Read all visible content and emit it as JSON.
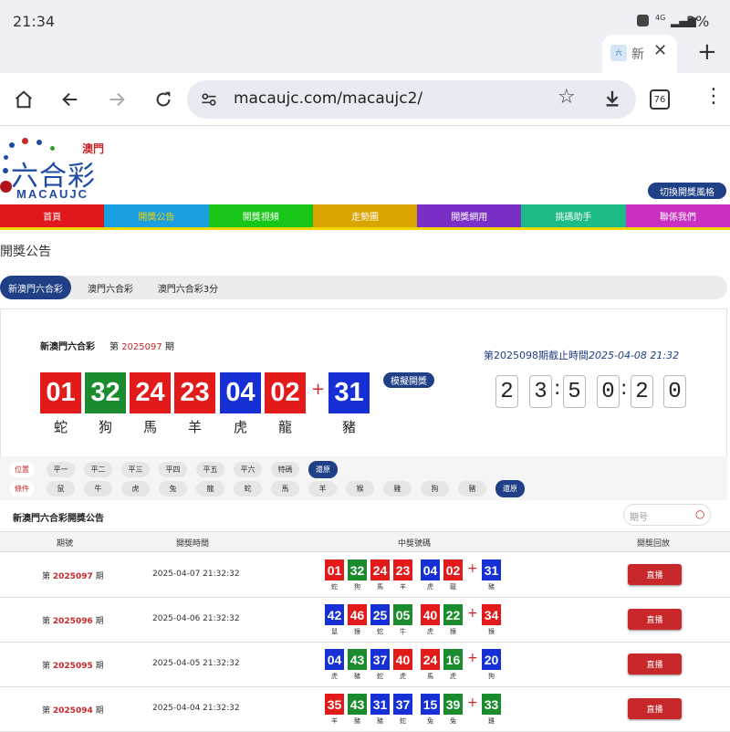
{
  "status_bar": {
    "time": "21:34",
    "signal": "4G",
    "battery": "3%"
  },
  "browser": {
    "tab_title": "新",
    "url": "macaujc.com/macaujc2/",
    "tab_count": "76"
  },
  "logo": {
    "city": "澳門",
    "title": "六合彩",
    "brand": "MACAUJC"
  },
  "switch_style_label": "切換開獎風格",
  "nav": [
    {
      "label": "首頁",
      "color": "#e0171d"
    },
    {
      "label": "開獎公告",
      "color": "#1a9fe0",
      "active_text_color": "#f2d600"
    },
    {
      "label": "開獎視頻",
      "color": "#17c617"
    },
    {
      "label": "走勢圖",
      "color": "#d9a300"
    },
    {
      "label": "開獎網用",
      "color": "#7a2fc7"
    },
    {
      "label": "挑碼助手",
      "color": "#1dbb86"
    },
    {
      "label": "聯係我們",
      "color": "#c930c2"
    }
  ],
  "page_heading": "開獎公告",
  "lottery_tabs": [
    "新澳門六合彩",
    "澳門六合彩",
    "澳門六合彩3分"
  ],
  "current_draw": {
    "name": "新澳門六合彩",
    "period_prefix": "第",
    "period": "2025097",
    "period_suffix": "期",
    "simulate_label": "模擬開獎",
    "plus": "+",
    "balls": [
      {
        "num": "01",
        "zodiac": "蛇",
        "color": "red"
      },
      {
        "num": "32",
        "zodiac": "狗",
        "color": "green"
      },
      {
        "num": "24",
        "zodiac": "馬",
        "color": "red"
      },
      {
        "num": "23",
        "zodiac": "羊",
        "color": "red"
      },
      {
        "num": "04",
        "zodiac": "虎",
        "color": "blue"
      },
      {
        "num": "02",
        "zodiac": "龍",
        "color": "red"
      }
    ],
    "special": {
      "num": "31",
      "zodiac": "豬",
      "color": "blue"
    }
  },
  "next_draw": {
    "label": "第2025098期截止時間",
    "datetime": "2025-04-08 21:32",
    "countdown_digits": [
      "2",
      "3",
      "5",
      "0",
      "2",
      "0"
    ]
  },
  "filters": {
    "position_label": "位置",
    "positions": [
      "平一",
      "平二",
      "平三",
      "平四",
      "平五",
      "平六",
      "特碼"
    ],
    "restore_label": "還原",
    "condition_label": "條件",
    "conditions": [
      "鼠",
      "牛",
      "虎",
      "兔",
      "龍",
      "蛇",
      "馬",
      "羊",
      "猴",
      "雞",
      "狗",
      "豬"
    ]
  },
  "history": {
    "title": "新澳門六合彩開獎公告",
    "search_placeholder": "期号",
    "columns": [
      "期號",
      "開獎時間",
      "中獎號碼",
      "開獎回放"
    ],
    "replay_label": "直播",
    "rows": [
      {
        "period": "2025097",
        "time": "2025-04-07 21:32:32",
        "balls": [
          [
            "01",
            "蛇",
            "red"
          ],
          [
            "32",
            "狗",
            "green"
          ],
          [
            "24",
            "馬",
            "red"
          ],
          [
            "23",
            "羊",
            "red"
          ],
          [
            "04",
            "虎",
            "blue"
          ],
          [
            "02",
            "龍",
            "red"
          ]
        ],
        "special": [
          "31",
          "豬",
          "blue"
        ]
      },
      {
        "period": "2025096",
        "time": "2025-04-06 21:32:32",
        "balls": [
          [
            "42",
            "鼠",
            "blue"
          ],
          [
            "46",
            "猴",
            "red"
          ],
          [
            "25",
            "蛇",
            "blue"
          ],
          [
            "05",
            "牛",
            "green"
          ],
          [
            "40",
            "虎",
            "red"
          ],
          [
            "22",
            "猴",
            "green"
          ]
        ],
        "special": [
          "34",
          "猴",
          "red"
        ]
      },
      {
        "period": "2025095",
        "time": "2025-04-05 21:32:32",
        "balls": [
          [
            "04",
            "虎",
            "blue"
          ],
          [
            "43",
            "豬",
            "green"
          ],
          [
            "37",
            "蛇",
            "blue"
          ],
          [
            "40",
            "虎",
            "red"
          ],
          [
            "24",
            "馬",
            "red"
          ],
          [
            "16",
            "虎",
            "green"
          ]
        ],
        "special": [
          "20",
          "狗",
          "blue"
        ]
      },
      {
        "period": "2025094",
        "time": "2025-04-04 21:32:32",
        "balls": [
          [
            "35",
            "羊",
            "red"
          ],
          [
            "43",
            "豬",
            "green"
          ],
          [
            "31",
            "豬",
            "blue"
          ],
          [
            "37",
            "蛇",
            "blue"
          ],
          [
            "15",
            "兔",
            "blue"
          ],
          [
            "39",
            "兔",
            "green"
          ]
        ],
        "special": [
          "33",
          "雞",
          "green"
        ]
      }
    ]
  }
}
